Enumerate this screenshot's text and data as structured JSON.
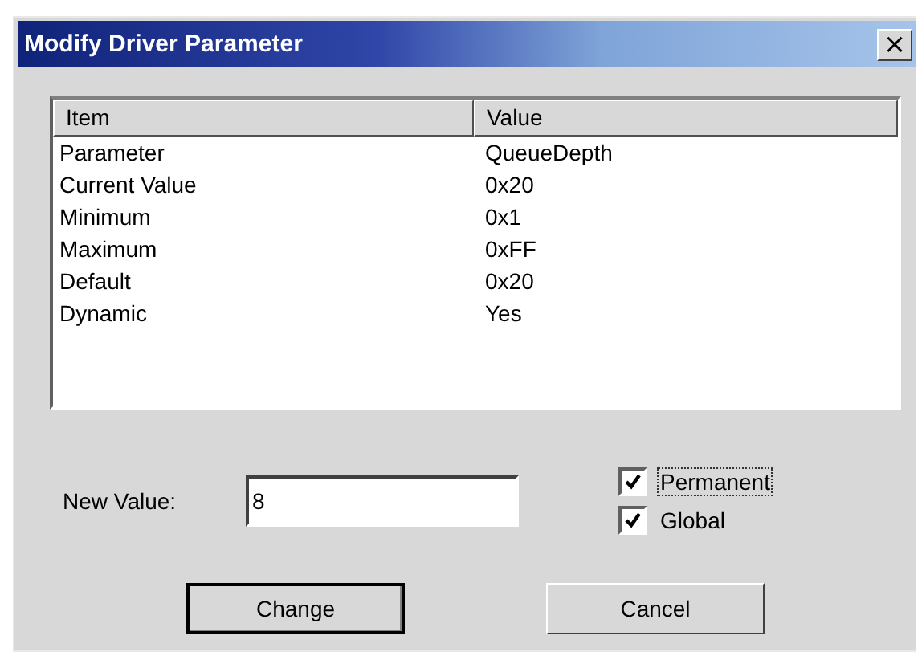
{
  "window": {
    "title": "Modify Driver Parameter",
    "close": "×"
  },
  "table": {
    "columns": [
      "Item",
      "Value"
    ],
    "rows": [
      [
        "Parameter",
        "QueueDepth"
      ],
      [
        "Current Value",
        "0x20"
      ],
      [
        "Minimum",
        "0x1"
      ],
      [
        "Maximum",
        "0xFF"
      ],
      [
        "Default",
        "0x20"
      ],
      [
        "Dynamic",
        "Yes"
      ]
    ]
  },
  "new_value": {
    "label": "New Value:",
    "value": "8"
  },
  "checkboxes": [
    {
      "label": "Permanent",
      "checked": true,
      "focused": true
    },
    {
      "label": "Global",
      "checked": true,
      "focused": false
    }
  ],
  "buttons": [
    {
      "label": "Change",
      "default": true
    },
    {
      "label": "Cancel",
      "default": false
    }
  ]
}
